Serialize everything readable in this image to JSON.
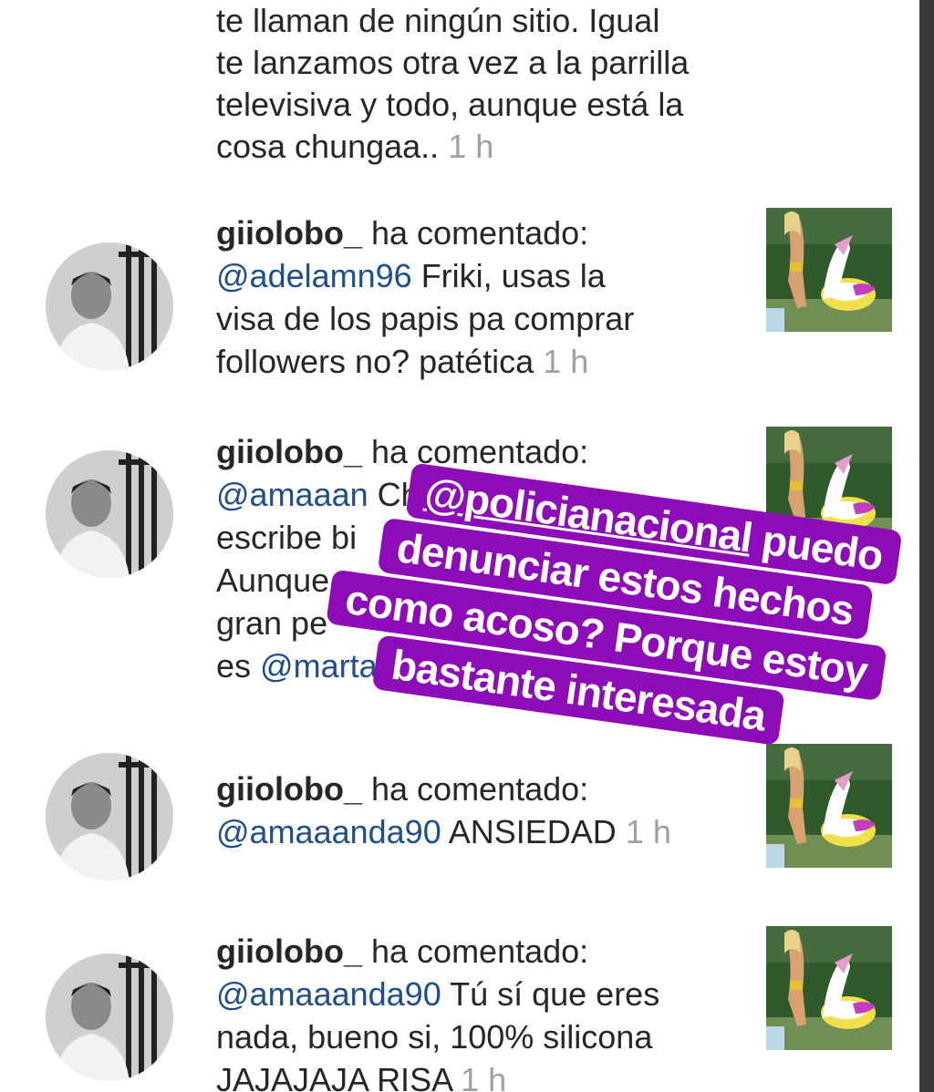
{
  "top_comment": {
    "lines": [
      "te llaman de ningún sitio. Igual",
      "te lanzamos otra vez a la parrilla",
      "televisiva y todo, aunque está la",
      "cosa chungaa.."
    ],
    "time": "1 h"
  },
  "comments": [
    {
      "username": "giiolobo_",
      "action": "ha comentado:",
      "mention": "@adelamn96",
      "text_first": " Friki, usas la",
      "more_lines": [
        "visa de los papis pa comprar",
        "followers no? patética"
      ],
      "time": "1 h"
    },
    {
      "username": "giiolobo_",
      "action": "ha comentado:",
      "mention": "@amaaan",
      "text_first": "    Chica, pero",
      "more_lines": [
        "escribe bi",
        "Aunque",
        "gran pe"
      ],
      "last_prefix": "es ",
      "last_mention": "@marta",
      "time": ""
    },
    {
      "username": "giiolobo_",
      "action": "ha comentado:",
      "mention": "@amaaanda90",
      "text_first": " ANSIEDAD",
      "more_lines": [],
      "time": "1 h"
    },
    {
      "username": "giiolobo_",
      "action": "ha comentado:",
      "mention": "@amaaanda90",
      "text_first": " Tú sí que eres",
      "more_lines": [
        "nada, bueno si, 100% silicona",
        "JAJAJAJA RISA"
      ],
      "time": "1 h"
    }
  ],
  "story_overlay": {
    "mention": "@policianacional",
    "line1_rest": " puedo",
    "line2": "denunciar estos hechos",
    "line3": "como acoso? Porque estoy",
    "line4": "bastante interesada",
    "color": "#8d0cb8"
  },
  "icons": {
    "avatar": "profile-photo",
    "thumbnail": "post-thumbnail"
  }
}
